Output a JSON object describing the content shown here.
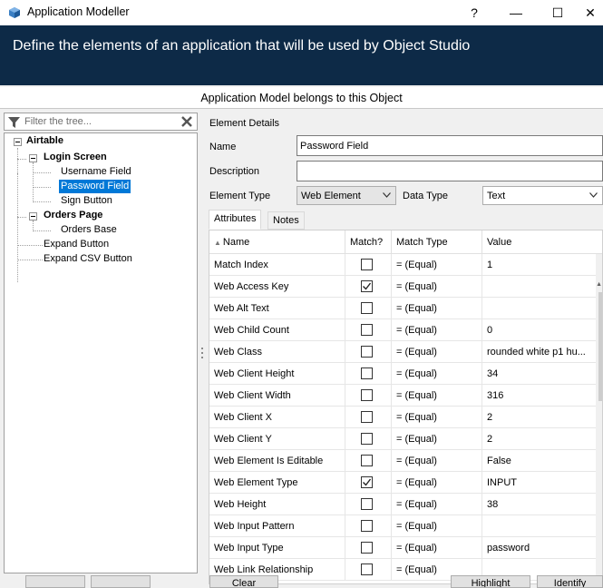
{
  "window": {
    "title": "Application Modeller",
    "help_label": "?",
    "minimize_label": "—",
    "maximize_label": "☐",
    "close_label": "✕"
  },
  "banner": {
    "text": "Define the elements of an application that will be used by Object Studio"
  },
  "subheader": {
    "text": "Application Model belongs to this Object"
  },
  "filter": {
    "placeholder": "Filter the tree..."
  },
  "tree": {
    "root": "Airtable",
    "login_screen": "Login Screen",
    "username_field": "Username Field",
    "password_field": "Password Field",
    "sign_button": "Sign Button",
    "orders_page": "Orders Page",
    "orders_base": "Orders Base",
    "expand_button": "Expand Button",
    "expand_csv_button": "Expand CSV Button"
  },
  "details": {
    "section_label": "Element Details",
    "name_label": "Name",
    "name_value": "Password Field",
    "description_label": "Description",
    "description_value": "",
    "element_type_label": "Element Type",
    "element_type_value": "Web Element",
    "data_type_label": "Data Type",
    "data_type_value": "Text"
  },
  "tabs": {
    "attributes": "Attributes",
    "notes": "Notes"
  },
  "grid": {
    "headers": {
      "name": "Name",
      "match": "Match?",
      "match_type": "Match Type",
      "value": "Value"
    },
    "rows": [
      {
        "name": "Match Index",
        "match": false,
        "match_type": "=  (Equal)",
        "value": "1"
      },
      {
        "name": "Web Access Key",
        "match": true,
        "match_type": "=  (Equal)",
        "value": ""
      },
      {
        "name": "Web Alt Text",
        "match": false,
        "match_type": "=  (Equal)",
        "value": ""
      },
      {
        "name": "Web Child Count",
        "match": false,
        "match_type": "=  (Equal)",
        "value": "0"
      },
      {
        "name": "Web Class",
        "match": false,
        "match_type": "=  (Equal)",
        "value": "rounded white p1 hu..."
      },
      {
        "name": "Web Client Height",
        "match": false,
        "match_type": "=  (Equal)",
        "value": "34"
      },
      {
        "name": "Web Client Width",
        "match": false,
        "match_type": "=  (Equal)",
        "value": "316"
      },
      {
        "name": "Web Client X",
        "match": false,
        "match_type": "=  (Equal)",
        "value": "2"
      },
      {
        "name": "Web Client Y",
        "match": false,
        "match_type": "=  (Equal)",
        "value": "2"
      },
      {
        "name": "Web Element Is Editable",
        "match": false,
        "match_type": "=  (Equal)",
        "value": "False"
      },
      {
        "name": "Web Element Type",
        "match": true,
        "match_type": "=  (Equal)",
        "value": "INPUT"
      },
      {
        "name": "Web Height",
        "match": false,
        "match_type": "=  (Equal)",
        "value": "38"
      },
      {
        "name": "Web Input Pattern",
        "match": false,
        "match_type": "=  (Equal)",
        "value": ""
      },
      {
        "name": "Web Input Type",
        "match": false,
        "match_type": "=  (Equal)",
        "value": "password"
      },
      {
        "name": "Web Link Relationship",
        "match": false,
        "match_type": "=  (Equal)",
        "value": ""
      }
    ]
  },
  "buttons": {
    "clear": "Clear",
    "highlight": "Highlight",
    "identify": "Identify"
  }
}
